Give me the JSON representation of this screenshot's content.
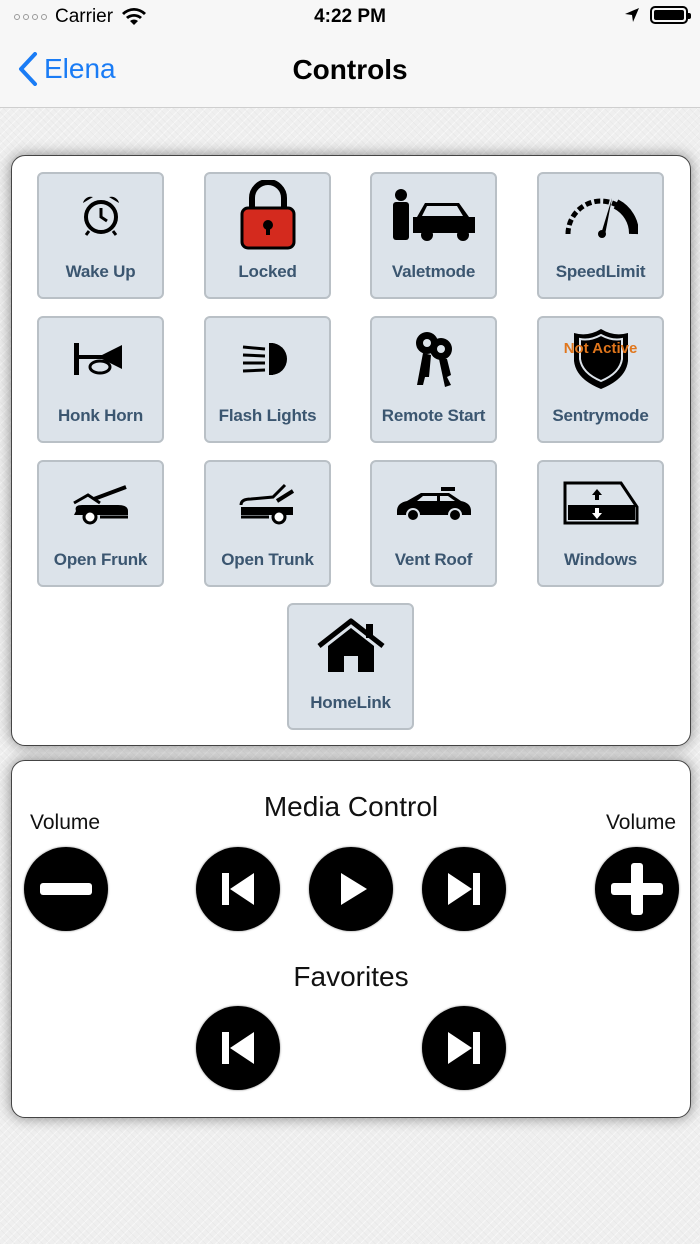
{
  "status": {
    "carrier": "Carrier",
    "time": "4:22 PM"
  },
  "nav": {
    "back_label": "Elena",
    "title": "Controls"
  },
  "controls": [
    {
      "label": "Wake Up",
      "icon": "alarm-clock-icon"
    },
    {
      "label": "Locked",
      "icon": "padlock-icon"
    },
    {
      "label": "Valetmode",
      "icon": "valet-car-icon"
    },
    {
      "label": "SpeedLimit",
      "icon": "speedometer-icon"
    },
    {
      "label": "Honk Horn",
      "icon": "horn-icon"
    },
    {
      "label": "Flash Lights",
      "icon": "headlight-icon"
    },
    {
      "label": "Remote Start",
      "icon": "car-keys-icon"
    },
    {
      "label": "Sentrymode",
      "icon": "shield-icon",
      "badge": "Not Active"
    },
    {
      "label": "Open Frunk",
      "icon": "open-frunk-icon"
    },
    {
      "label": "Open Trunk",
      "icon": "open-trunk-icon"
    },
    {
      "label": "Vent Roof",
      "icon": "vent-roof-car-icon"
    },
    {
      "label": "Windows",
      "icon": "window-icon"
    },
    {
      "label": "HomeLink",
      "icon": "house-icon"
    }
  ],
  "media": {
    "title": "Media Control",
    "volume_left": "Volume",
    "volume_right": "Volume",
    "favorites_title": "Favorites"
  },
  "colors": {
    "tile_bg": "#dce3ea",
    "tile_label": "#3b5670",
    "accent": "#1a7cf5",
    "lock_red": "#d42a1e",
    "badge_orange": "#e0761c"
  }
}
